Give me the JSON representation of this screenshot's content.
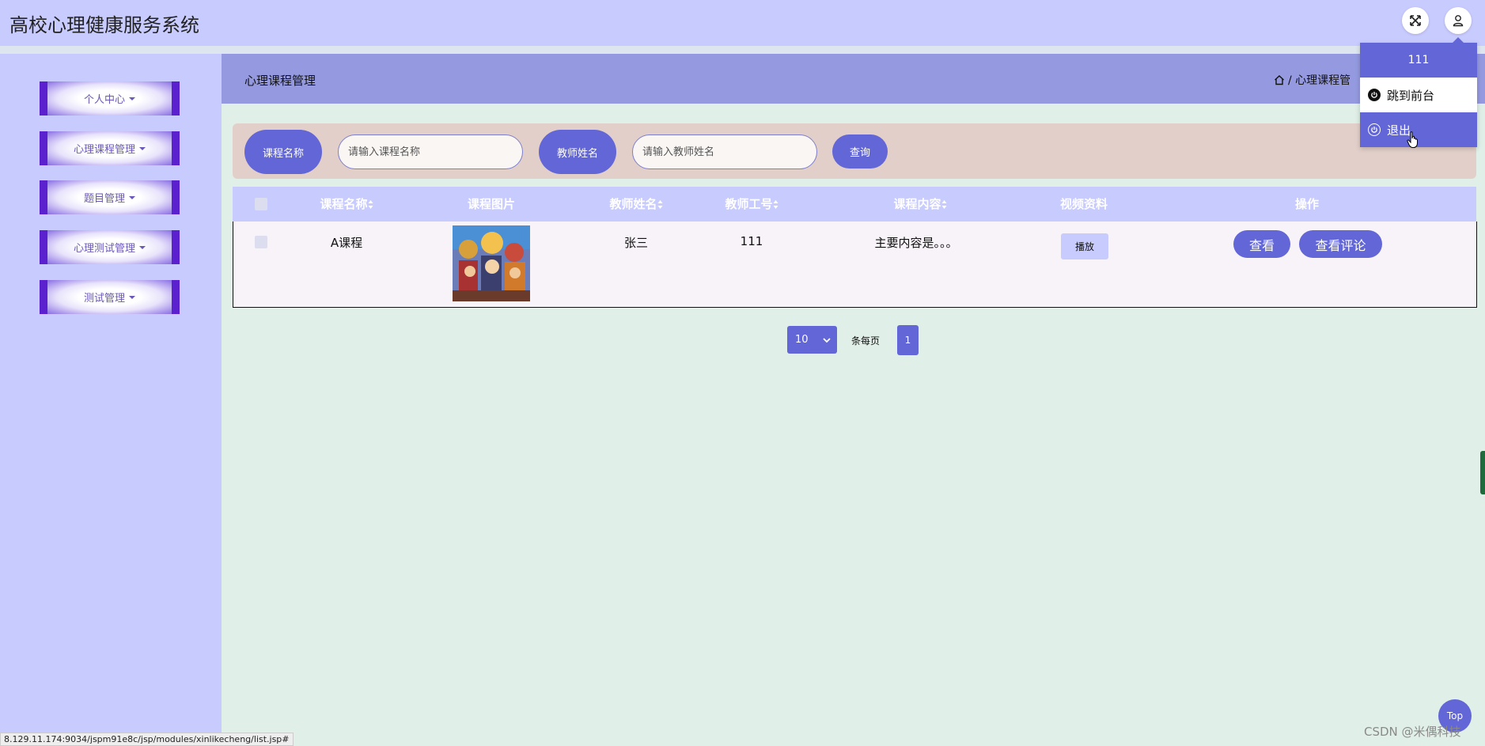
{
  "app": {
    "title": "高校心理健康服务系统"
  },
  "header_icons": [
    "fullscreen-icon",
    "user-icon"
  ],
  "sidebar": {
    "items": [
      {
        "label": "个人中心"
      },
      {
        "label": "心理课程管理"
      },
      {
        "label": "题目管理"
      },
      {
        "label": "心理测试管理"
      },
      {
        "label": "测试管理"
      }
    ]
  },
  "page": {
    "title": "心理课程管理",
    "breadcrumb": "/ 心理课程管"
  },
  "search": {
    "course_label": "课程名称",
    "course_placeholder": "请输入课程名称",
    "teacher_label": "教师姓名",
    "teacher_placeholder": "请输入教师姓名",
    "query_button": "查询"
  },
  "table": {
    "columns": [
      "课程名称",
      "课程图片",
      "教师姓名",
      "教师工号",
      "课程内容",
      "视频资料",
      "操作"
    ],
    "rows": [
      {
        "course_name": "A课程",
        "teacher_name": "张三",
        "teacher_id": "111",
        "content": "主要内容是。。。",
        "video_button": "播放",
        "view_button": "查看",
        "comment_button": "查看评论"
      }
    ]
  },
  "pagination": {
    "page_size": "10",
    "per_page_label": "条每页",
    "current_page": "1"
  },
  "user_menu": {
    "username": "111",
    "goto_front": "跳到前台",
    "logout": "退出"
  },
  "floating": {
    "top_button": "Top"
  },
  "status_bar": {
    "url": "8.129.11.174:9034/jspm91e8c/jsp/modules/xinlikecheng/list.jsp#"
  },
  "watermark": "CSDN @米偶科技",
  "colors": {
    "primary": "#6266d6",
    "sidebar": "#c8cbfe",
    "header": "#959ae0",
    "menu_border": "#5c21cf"
  }
}
